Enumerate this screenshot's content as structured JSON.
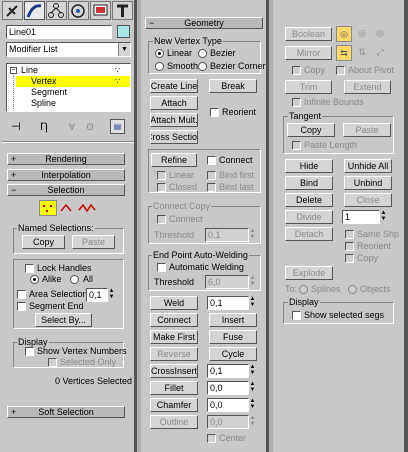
{
  "tabs": [
    "create-tab",
    "modify-tab",
    "hierarchy-tab",
    "motion-tab",
    "display-tab",
    "utilities-tab"
  ],
  "object_name": "Line01",
  "modifier_list": "Modifier List",
  "stack": {
    "items": [
      {
        "label": "Line",
        "sign": "−"
      },
      {
        "label": "Vertex"
      },
      {
        "label": "Segment"
      },
      {
        "label": "Spline"
      }
    ]
  },
  "rollouts": {
    "rendering": {
      "sign": "+",
      "label": "Rendering"
    },
    "interpolation": {
      "sign": "+",
      "label": "Interpolation"
    },
    "selection": {
      "sign": "−",
      "label": "Selection"
    },
    "soft_selection": {
      "sign": "+",
      "label": "Soft Selection"
    },
    "geometry": {
      "sign": "−",
      "label": "Geometry"
    }
  },
  "selection": {
    "named_selections_label": "Named Selections:",
    "copy": "Copy",
    "paste": "Paste",
    "lock_handles": "Lock Handles",
    "alike": "Alike",
    "all": "All",
    "area_selection": "Area Selection:",
    "area_value": "0,1",
    "segment_end": "Segment End",
    "select_by": "Select By...",
    "display_label": "Display",
    "show_vertex_numbers": "Show Vertex Numbers",
    "selected_only": "Selected Only",
    "status": "0 Vertices Selected"
  },
  "geometry": {
    "new_vertex_type": "New Vertex Type",
    "linear": "Linear",
    "bezier": "Bezier",
    "smooth": "Smooth",
    "bezier_corner": "Bezier Corner",
    "create_line": "Create Line",
    "break": "Break",
    "attach": "Attach",
    "reorient": "Reorient",
    "attach_mult": "Attach Mult.",
    "cross_section": "Cross Section",
    "refine": "Refine",
    "connect": "Connect",
    "linear_chk": "Linear",
    "bind_first": "Bind first",
    "closed": "Closed",
    "bind_last": "Bind last",
    "connect_copy": "Connect Copy",
    "connect_chk": "Connect",
    "threshold": "Threshold",
    "threshold_value1": "0,1",
    "end_point_welding": "End Point Auto-Welding",
    "automatic_welding": "Automatic Welding",
    "threshold_value2": "6,0",
    "weld": "Weld",
    "weld_value": "0,1",
    "connect_btn": "Connect",
    "insert": "Insert",
    "make_first": "Make First",
    "fuse": "Fuse",
    "reverse": "Reverse",
    "cycle": "Cycle",
    "crossinsert": "CrossInsert",
    "crossinsert_value": "0,1",
    "fillet": "Fillet",
    "fillet_value": "0,0",
    "chamfer": "Chamfer",
    "chamfer_value": "0,0",
    "outline": "Outline",
    "outline_value": "0,0",
    "center": "Center"
  },
  "right": {
    "boolean": "Boolean",
    "mirror": "Mirror",
    "copy": "Copy",
    "about_pivot": "About Pivot",
    "trim": "Trim",
    "extend": "Extend",
    "infinite_bounds": "Infinite Bounds",
    "tangent": "Tangent",
    "tan_copy": "Copy",
    "tan_paste": "Paste",
    "paste_length": "Paste Length",
    "hide": "Hide",
    "unhide_all": "Unhide All",
    "bind": "Bind",
    "unbind": "Unbind",
    "delete": "Delete",
    "close": "Close",
    "divide": "Divide",
    "divide_value": "1",
    "detach": "Detach",
    "same_shp": "Same Shp",
    "reorient": "Reorient",
    "copy_chk": "Copy",
    "explode": "Explode",
    "to_label": "To:",
    "splines": "Splines",
    "objects": "Objects",
    "display": "Display",
    "show_selected_segs": "Show selected segs"
  },
  "colors": {
    "accent": "#ffff00",
    "panel": "#c8c8c8",
    "stack_selected": "#ffff00"
  }
}
